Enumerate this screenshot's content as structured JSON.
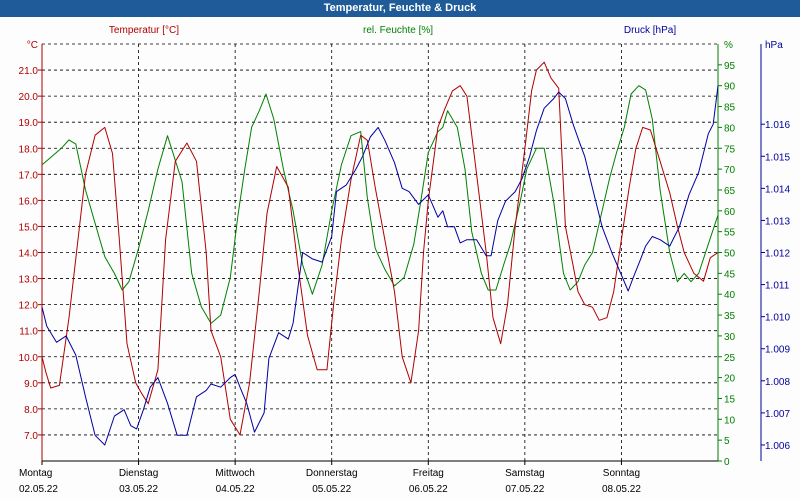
{
  "window": {
    "title": "Temperatur, Feuchte & Druck"
  },
  "chart_data": {
    "type": "line",
    "title": "Temperatur, Feuchte & Druck",
    "colors": {
      "temperature": "#b00000",
      "humidity": "#008000",
      "pressure": "#0000a0",
      "title_bar": "#1f5b98"
    },
    "grid": true,
    "axes": {
      "left": {
        "unit": "°C",
        "ylim": [
          6.0,
          22.0
        ],
        "ticks": [
          "7.0",
          "8.0",
          "9.0",
          "10.0",
          "11.0",
          "12.0",
          "13.0",
          "14.0",
          "15.0",
          "16.0",
          "17.0",
          "18.0",
          "19.0",
          "20.0",
          "21.0"
        ]
      },
      "right_humidity": {
        "unit": "%",
        "ylim": [
          0,
          100
        ],
        "ticks": [
          "0",
          "5",
          "10",
          "15",
          "20",
          "25",
          "30",
          "35",
          "40",
          "45",
          "50",
          "55",
          "60",
          "65",
          "70",
          "75",
          "80",
          "85",
          "90",
          "95"
        ]
      },
      "right_pressure": {
        "unit": "hPa",
        "ylim": [
          1.0055,
          1.0185
        ],
        "ticks": [
          "1.006",
          "1.007",
          "1.008",
          "1.009",
          "1.010",
          "1.011",
          "1.012",
          "1.013",
          "1.014",
          "1.015",
          "1.016"
        ]
      },
      "x": {
        "range_days": [
          0,
          7
        ],
        "days": [
          {
            "name": "Montag",
            "date": "02.05.22"
          },
          {
            "name": "Dienstag",
            "date": "03.05.22"
          },
          {
            "name": "Mittwoch",
            "date": "04.05.22"
          },
          {
            "name": "Donnerstag",
            "date": "05.05.22"
          },
          {
            "name": "Freitag",
            "date": "06.05.22"
          },
          {
            "name": "Samstag",
            "date": "07.05.22"
          },
          {
            "name": "Sonntag",
            "date": "08.05.22"
          }
        ]
      }
    },
    "series": [
      {
        "name": "Temperatur [°C]",
        "axis": "left",
        "x": [
          0.0,
          0.04,
          0.09,
          0.18,
          0.28,
          0.45,
          0.55,
          0.65,
          0.73,
          0.8,
          0.88,
          0.97,
          1.03,
          1.1,
          1.2,
          1.28,
          1.38,
          1.5,
          1.6,
          1.7,
          1.75,
          1.85,
          1.95,
          2.05,
          2.15,
          2.25,
          2.33,
          2.43,
          2.55,
          2.65,
          2.75,
          2.85,
          2.95,
          3.02,
          3.1,
          3.2,
          3.3,
          3.37,
          3.45,
          3.55,
          3.65,
          3.73,
          3.82,
          3.9,
          3.95,
          4.0,
          4.1,
          4.17,
          4.25,
          4.33,
          4.4,
          4.5,
          4.6,
          4.67,
          4.75,
          4.82,
          4.9,
          5.0,
          5.07,
          5.12,
          5.2,
          5.27,
          5.35,
          5.42,
          5.5,
          5.55,
          5.62,
          5.7,
          5.77,
          5.85,
          5.92,
          6.0,
          6.08,
          6.15,
          6.22,
          6.3,
          6.4,
          6.5,
          6.58,
          6.65,
          6.75,
          6.85,
          6.92,
          7.0
        ],
        "values": [
          10.0,
          9.4,
          8.8,
          8.9,
          11.5,
          17.0,
          18.5,
          18.8,
          17.8,
          14.5,
          10.5,
          9.0,
          8.6,
          8.2,
          9.5,
          14.5,
          17.5,
          18.2,
          17.5,
          14.0,
          11.0,
          10.0,
          7.6,
          7.0,
          9.0,
          12.5,
          15.5,
          17.3,
          16.5,
          13.5,
          10.8,
          9.5,
          9.5,
          12.0,
          14.5,
          16.8,
          18.5,
          18.3,
          16.5,
          14.5,
          12.5,
          10.0,
          9.0,
          11.0,
          14.0,
          16.0,
          18.8,
          19.5,
          20.2,
          20.4,
          20.0,
          17.0,
          14.0,
          11.5,
          10.5,
          12.0,
          15.0,
          18.0,
          20.2,
          21.0,
          21.3,
          20.7,
          20.3,
          15.0,
          13.5,
          12.5,
          12.0,
          11.9,
          11.4,
          11.5,
          12.5,
          14.5,
          16.5,
          18.0,
          18.8,
          18.7,
          17.5,
          16.3,
          15.0,
          14.0,
          13.2,
          12.9,
          13.8,
          14.0
        ]
      },
      {
        "name": "rel. Feuchte [%]",
        "axis": "right_humidity",
        "x": [
          0.0,
          0.1,
          0.2,
          0.28,
          0.35,
          0.45,
          0.55,
          0.65,
          0.75,
          0.83,
          0.9,
          1.0,
          1.1,
          1.2,
          1.3,
          1.45,
          1.55,
          1.65,
          1.75,
          1.85,
          1.95,
          2.03,
          2.1,
          2.17,
          2.25,
          2.32,
          2.4,
          2.5,
          2.6,
          2.7,
          2.8,
          2.9,
          3.0,
          3.1,
          3.2,
          3.3,
          3.37,
          3.45,
          3.55,
          3.65,
          3.75,
          3.85,
          3.92,
          4.0,
          4.1,
          4.15,
          4.2,
          4.3,
          4.38,
          4.45,
          4.55,
          4.62,
          4.7,
          4.78,
          4.85,
          4.95,
          5.02,
          5.12,
          5.2,
          5.3,
          5.4,
          5.47,
          5.55,
          5.62,
          5.7,
          5.8,
          5.88,
          5.95,
          6.03,
          6.1,
          6.18,
          6.25,
          6.32,
          6.4,
          6.5,
          6.58,
          6.65,
          6.72,
          6.8,
          6.9,
          7.0
        ],
        "values": [
          71,
          73,
          75,
          77,
          76,
          65,
          57,
          49,
          45,
          41,
          43,
          51,
          60,
          70,
          78,
          67,
          45,
          37,
          33,
          35,
          44,
          59,
          70,
          80,
          84,
          88,
          82,
          70,
          60,
          47,
          40,
          47,
          60,
          71,
          78,
          79,
          63,
          51,
          46,
          42,
          44,
          52,
          62,
          74,
          79,
          80,
          84,
          80,
          70,
          55,
          45,
          41,
          41,
          47,
          52,
          62,
          70,
          75,
          75,
          62,
          45,
          41,
          43,
          47,
          50,
          60,
          68,
          74,
          80,
          88,
          90,
          89,
          82,
          65,
          50,
          43,
          45,
          43,
          45,
          52,
          59
        ]
      },
      {
        "name": "Druck [hPa]",
        "axis": "right_pressure",
        "x": [
          0.0,
          0.05,
          0.15,
          0.25,
          0.35,
          0.45,
          0.55,
          0.65,
          0.75,
          0.85,
          0.92,
          0.98,
          1.05,
          1.12,
          1.2,
          1.3,
          1.4,
          1.5,
          1.6,
          1.7,
          1.75,
          1.85,
          1.95,
          2.0,
          2.05,
          2.12,
          2.2,
          2.3,
          2.35,
          2.45,
          2.55,
          2.6,
          2.7,
          2.8,
          2.9,
          3.0,
          3.05,
          3.15,
          3.25,
          3.32,
          3.4,
          3.48,
          3.55,
          3.65,
          3.73,
          3.8,
          3.9,
          4.0,
          4.1,
          4.15,
          4.2,
          4.27,
          4.33,
          4.4,
          4.5,
          4.6,
          4.65,
          4.72,
          4.8,
          4.9,
          4.97,
          5.05,
          5.12,
          5.2,
          5.3,
          5.35,
          5.42,
          5.5,
          5.57,
          5.62,
          5.7,
          5.8,
          5.9,
          6.0,
          6.07,
          6.12,
          6.2,
          6.25,
          6.32,
          6.4,
          6.5,
          6.6,
          6.7,
          6.8,
          6.85,
          6.9,
          6.95,
          7.0
        ],
        "values": [
          1.0103,
          1.0097,
          1.0092,
          1.0094,
          1.0088,
          1.0075,
          1.0063,
          1.006,
          1.0069,
          1.0071,
          1.0066,
          1.0065,
          1.0071,
          1.0078,
          1.0081,
          1.0073,
          1.0063,
          1.0063,
          1.0075,
          1.0077,
          1.0079,
          1.0078,
          1.0081,
          1.0082,
          1.0078,
          1.0073,
          1.0064,
          1.007,
          1.0087,
          1.0095,
          1.0093,
          1.0098,
          1.012,
          1.0118,
          1.0117,
          1.0125,
          1.0139,
          1.0141,
          1.0146,
          1.015,
          1.0156,
          1.0159,
          1.0155,
          1.0148,
          1.014,
          1.0139,
          1.0135,
          1.0138,
          1.0131,
          1.0133,
          1.0128,
          1.0128,
          1.0123,
          1.0124,
          1.0124,
          1.0119,
          1.0119,
          1.013,
          1.0136,
          1.0139,
          1.0143,
          1.015,
          1.0158,
          1.0165,
          1.0168,
          1.017,
          1.0168,
          1.016,
          1.0154,
          1.015,
          1.014,
          1.0128,
          1.012,
          1.0113,
          1.0108,
          1.0112,
          1.0118,
          1.0122,
          1.0125,
          1.0124,
          1.0122,
          1.0128,
          1.0138,
          1.0145,
          1.0151,
          1.0157,
          1.016,
          1.0172
        ]
      }
    ]
  }
}
